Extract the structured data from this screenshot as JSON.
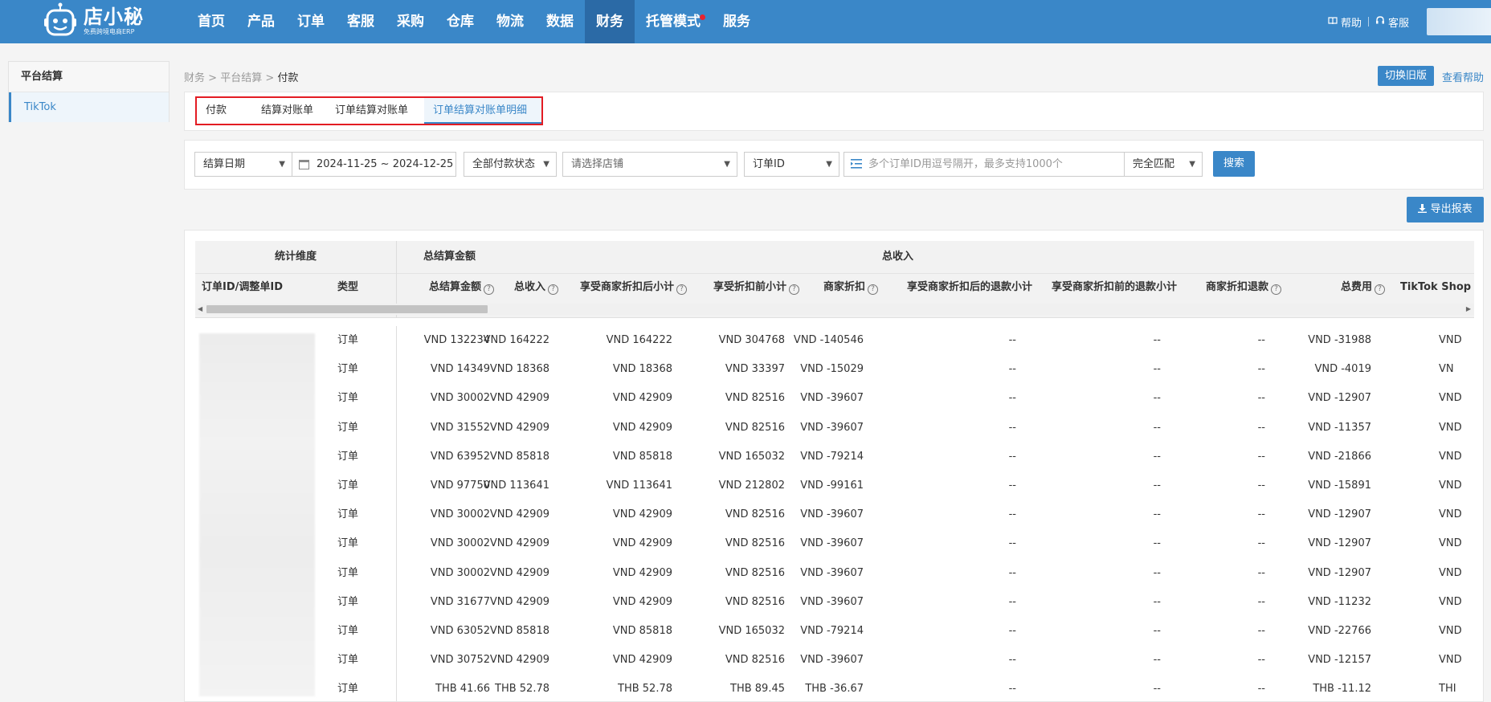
{
  "header": {
    "logo_name": "店小秘",
    "logo_sub": "免费跨境电商ERP",
    "nav": [
      "首页",
      "产品",
      "订单",
      "客服",
      "采购",
      "仓库",
      "物流",
      "数据",
      "财务",
      "托管模式",
      "服务"
    ],
    "active_nav": "财务",
    "help_label": "帮助",
    "service_label": "客服",
    "accent": "#3a87c8"
  },
  "sidebar": {
    "title": "平台结算",
    "items": [
      {
        "label": "TikTok",
        "active": true
      }
    ]
  },
  "breadcrumb": {
    "p1": "财务",
    "p2": "平台结算",
    "current": "付款",
    "sep": ">"
  },
  "actions": {
    "switch_old": "切换旧版",
    "view_help": "查看帮助",
    "export": "导出报表"
  },
  "tabs": [
    {
      "label": "付款"
    },
    {
      "label": "结算对账单"
    },
    {
      "label": "订单结算对账单"
    },
    {
      "label": "订单结算对账单明细",
      "active": true
    }
  ],
  "filters": {
    "date_type": "结算日期",
    "date_range": "2024-11-25 ~ 2024-12-25",
    "pay_status": "全部付款状态",
    "shop_placeholder": "请选择店铺",
    "id_type": "订单ID",
    "id_placeholder": "多个订单ID用逗号隔开，最多支持1000个",
    "match_mode": "完全匹配",
    "search": "搜索"
  },
  "table": {
    "group_headers": {
      "dimension": "统计维度",
      "total_settle": "总结算金额",
      "total_income": "总收入"
    },
    "columns": {
      "order_id": "订单ID/调整单ID",
      "type": "类型",
      "total_settle": "总结算金额",
      "total_income": "总收入",
      "after_discount_subtotal": "享受商家折扣后小计",
      "before_discount_subtotal": "享受折扣前小计",
      "merchant_discount": "商家折扣",
      "after_discount_refund": "享受商家折扣后的退款小计",
      "before_discount_refund": "享受商家折扣前的退款小计",
      "merchant_discount_refund": "商家折扣退款",
      "total_fee": "总费用",
      "tiktok_commission": "TikTok Shop 佣金"
    },
    "rows": [
      {
        "type": "订单",
        "settle": "VND 132234",
        "income": "VND 164222",
        "after": "VND 164222",
        "before": "VND 304768",
        "discount": "VND -140546",
        "r1": "--",
        "r2": "--",
        "r3": "--",
        "fee": "VND -31988",
        "comm": "VND"
      },
      {
        "type": "订单",
        "settle": "VND 14349",
        "income": "VND 18368",
        "after": "VND 18368",
        "before": "VND 33397",
        "discount": "VND -15029",
        "r1": "--",
        "r2": "--",
        "r3": "--",
        "fee": "VND -4019",
        "comm": "VN"
      },
      {
        "type": "订单",
        "settle": "VND 30002",
        "income": "VND 42909",
        "after": "VND 42909",
        "before": "VND 82516",
        "discount": "VND -39607",
        "r1": "--",
        "r2": "--",
        "r3": "--",
        "fee": "VND -12907",
        "comm": "VND"
      },
      {
        "type": "订单",
        "settle": "VND 31552",
        "income": "VND 42909",
        "after": "VND 42909",
        "before": "VND 82516",
        "discount": "VND -39607",
        "r1": "--",
        "r2": "--",
        "r3": "--",
        "fee": "VND -11357",
        "comm": "VND"
      },
      {
        "type": "订单",
        "settle": "VND 63952",
        "income": "VND 85818",
        "after": "VND 85818",
        "before": "VND 165032",
        "discount": "VND -79214",
        "r1": "--",
        "r2": "--",
        "r3": "--",
        "fee": "VND -21866",
        "comm": "VND"
      },
      {
        "type": "订单",
        "settle": "VND 97750",
        "income": "VND 113641",
        "after": "VND 113641",
        "before": "VND 212802",
        "discount": "VND -99161",
        "r1": "--",
        "r2": "--",
        "r3": "--",
        "fee": "VND -15891",
        "comm": "VND"
      },
      {
        "type": "订单",
        "settle": "VND 30002",
        "income": "VND 42909",
        "after": "VND 42909",
        "before": "VND 82516",
        "discount": "VND -39607",
        "r1": "--",
        "r2": "--",
        "r3": "--",
        "fee": "VND -12907",
        "comm": "VND"
      },
      {
        "type": "订单",
        "settle": "VND 30002",
        "income": "VND 42909",
        "after": "VND 42909",
        "before": "VND 82516",
        "discount": "VND -39607",
        "r1": "--",
        "r2": "--",
        "r3": "--",
        "fee": "VND -12907",
        "comm": "VND"
      },
      {
        "type": "订单",
        "settle": "VND 30002",
        "income": "VND 42909",
        "after": "VND 42909",
        "before": "VND 82516",
        "discount": "VND -39607",
        "r1": "--",
        "r2": "--",
        "r3": "--",
        "fee": "VND -12907",
        "comm": "VND"
      },
      {
        "type": "订单",
        "settle": "VND 31677",
        "income": "VND 42909",
        "after": "VND 42909",
        "before": "VND 82516",
        "discount": "VND -39607",
        "r1": "--",
        "r2": "--",
        "r3": "--",
        "fee": "VND -11232",
        "comm": "VND"
      },
      {
        "type": "订单",
        "settle": "VND 63052",
        "income": "VND 85818",
        "after": "VND 85818",
        "before": "VND 165032",
        "discount": "VND -79214",
        "r1": "--",
        "r2": "--",
        "r3": "--",
        "fee": "VND -22766",
        "comm": "VND"
      },
      {
        "type": "订单",
        "settle": "VND 30752",
        "income": "VND 42909",
        "after": "VND 42909",
        "before": "VND 82516",
        "discount": "VND -39607",
        "r1": "--",
        "r2": "--",
        "r3": "--",
        "fee": "VND -12157",
        "comm": "VND"
      },
      {
        "type": "订单",
        "settle": "THB 41.66",
        "income": "THB 52.78",
        "after": "THB 52.78",
        "before": "THB 89.45",
        "discount": "THB -36.67",
        "r1": "--",
        "r2": "--",
        "r3": "--",
        "fee": "THB -11.12",
        "comm": "THI"
      }
    ]
  }
}
